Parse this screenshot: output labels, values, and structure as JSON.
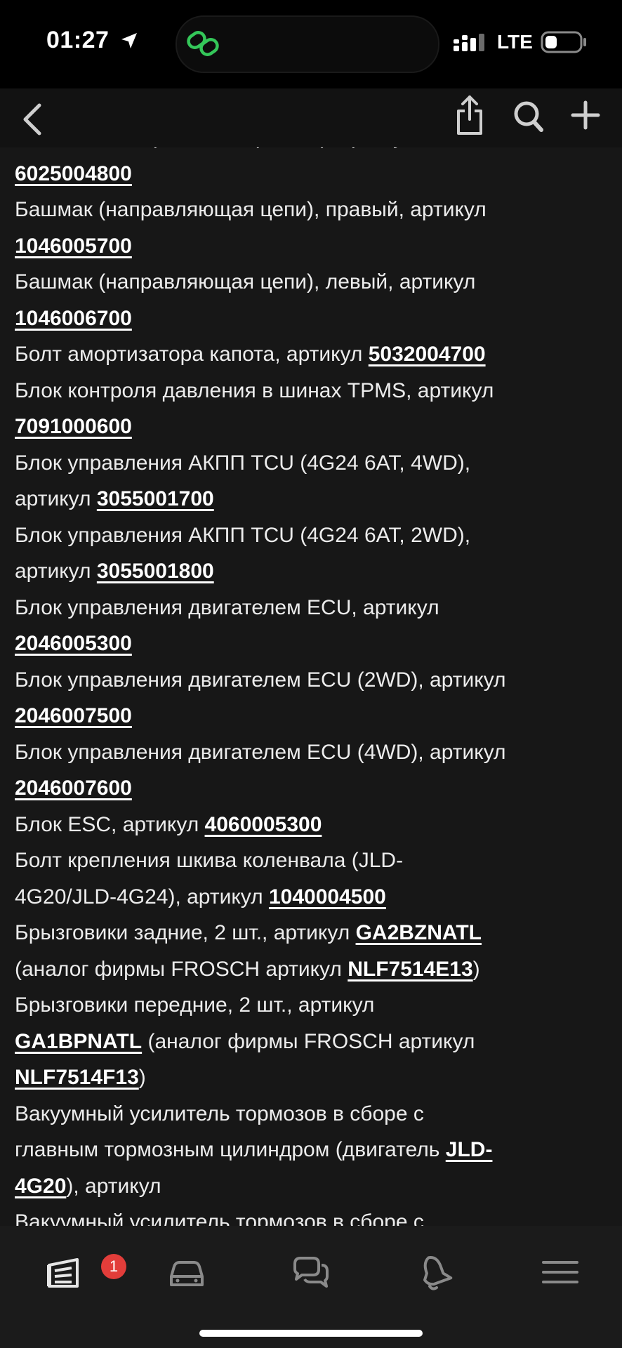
{
  "status_bar": {
    "time": "01:27",
    "network": "LTE"
  },
  "nav": {
    "icons": [
      "back-icon",
      "share-icon",
      "search-icon",
      "plus-icon"
    ]
  },
  "content": {
    "lines": [
      [
        {
          "t": "омывателя, горловина, крышка), артикул"
        }
      ],
      [
        {
          "t": "6025004800",
          "link": true
        }
      ],
      [
        {
          "t": "Башмак (направляющая цепи), правый, артикул"
        }
      ],
      [
        {
          "t": "1046005700",
          "link": true
        }
      ],
      [
        {
          "t": "Башмак (направляющая цепи), левый, артикул"
        }
      ],
      [
        {
          "t": "1046006700",
          "link": true
        }
      ],
      [
        {
          "t": "Болт амортизатора капота, артикул "
        },
        {
          "t": "5032004700",
          "link": true
        }
      ],
      [
        {
          "t": "Блок контроля давления в шинах TPMS, артикул"
        }
      ],
      [
        {
          "t": "7091000600",
          "link": true
        }
      ],
      [
        {
          "t": "Блок управления АКПП TCU (4G24 6AT, 4WD),"
        }
      ],
      [
        {
          "t": "артикул "
        },
        {
          "t": "3055001700",
          "link": true
        }
      ],
      [
        {
          "t": "Блок управления АКПП TCU (4G24 6AT, 2WD),"
        }
      ],
      [
        {
          "t": "артикул "
        },
        {
          "t": "3055001800",
          "link": true
        }
      ],
      [
        {
          "t": "Блок управления двигателем ECU, артикул"
        }
      ],
      [
        {
          "t": "2046005300",
          "link": true
        }
      ],
      [
        {
          "t": "Блок управления двигателем ECU (2WD), артикул"
        }
      ],
      [
        {
          "t": "2046007500",
          "link": true
        }
      ],
      [
        {
          "t": "Блок управления двигателем ECU (4WD), артикул"
        }
      ],
      [
        {
          "t": "2046007600",
          "link": true
        }
      ],
      [
        {
          "t": "Блок ESC, артикул "
        },
        {
          "t": "4060005300",
          "link": true
        }
      ],
      [
        {
          "t": "Болт крепления шкива коленвала (JLD-"
        }
      ],
      [
        {
          "t": "4G20/JLD-4G24), артикул "
        },
        {
          "t": "1040004500",
          "link": true
        }
      ],
      [
        {
          "t": "Брызговики задние, 2 шт., артикул "
        },
        {
          "t": "GA2BZNATL",
          "link": true
        }
      ],
      [
        {
          "t": "(аналог фирмы FROSCH артикул "
        },
        {
          "t": "NLF7514E13",
          "link": true
        },
        {
          "t": ")"
        }
      ],
      [
        {
          "t": "Брызговики передние, 2 шт., артикул"
        }
      ],
      [
        {
          "t": "GA1BPNATL",
          "link": true
        },
        {
          "t": " (аналог фирмы FROSCH артикул"
        }
      ],
      [
        {
          "t": "NLF7514F13",
          "link": true
        },
        {
          "t": ")"
        }
      ],
      [
        {
          "t": "Вакуумный усилитель тормозов в сборе с"
        }
      ],
      [
        {
          "t": "главным тормозным цилиндром (двигатель "
        },
        {
          "t": "JLD-",
          "link": true
        }
      ],
      [
        {
          "t": "4G20",
          "link": true
        },
        {
          "t": "), артикул"
        }
      ],
      [
        {
          "t": "Вакуумный усилитель тормозов в сборе с"
        }
      ]
    ]
  },
  "tab_bar": {
    "tabs": [
      {
        "name": "tab-feed",
        "icon": "feed-icon"
      },
      {
        "name": "tab-garage",
        "icon": "car-icon"
      },
      {
        "name": "tab-messages",
        "icon": "chat-icon"
      },
      {
        "name": "tab-notifications",
        "icon": "bell-icon"
      },
      {
        "name": "tab-menu",
        "icon": "menu-icon"
      }
    ],
    "badge": "1"
  },
  "colors": {
    "background": "#171717",
    "badge": "#e23d3a",
    "text": "#ececec",
    "link": "#ffffff"
  }
}
